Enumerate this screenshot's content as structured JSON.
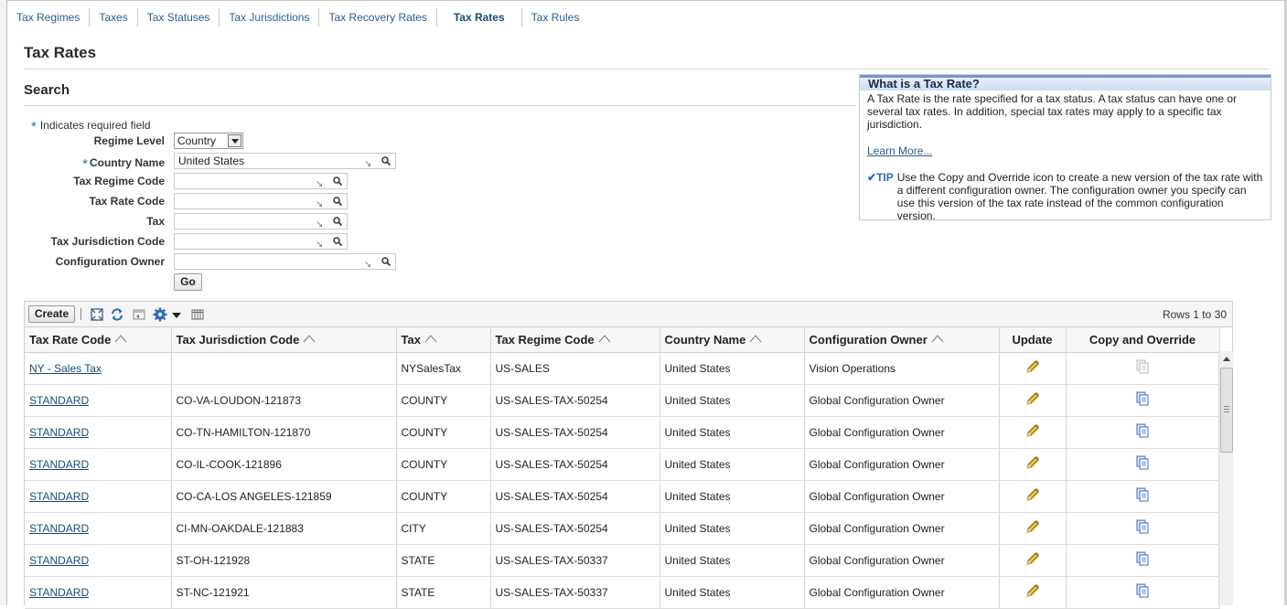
{
  "subtabs": [
    {
      "label": "Tax Regimes"
    },
    {
      "label": "Taxes"
    },
    {
      "label": "Tax Statuses"
    },
    {
      "label": "Tax Jurisdictions"
    },
    {
      "label": "Tax Recovery Rates"
    },
    {
      "label": "Tax Rates",
      "active": true
    },
    {
      "label": "Tax Rules"
    }
  ],
  "page": {
    "title": "Tax Rates",
    "search_title": "Search",
    "required_note": "Indicates required field"
  },
  "form": {
    "regime_level_label": "Regime Level",
    "regime_level_value": "Country",
    "country_name_label": "Country Name",
    "country_name_value": "United States",
    "tax_regime_code_label": "Tax Regime Code",
    "tax_rate_code_label": "Tax Rate Code",
    "tax_label": "Tax",
    "tax_jurisdiction_code_label": "Tax Jurisdiction Code",
    "configuration_owner_label": "Configuration Owner",
    "go_label": "Go"
  },
  "info": {
    "title": "What is a Tax Rate?",
    "text": "A Tax Rate is the rate specified for a tax status. A tax status can have one or several tax rates. In addition, special tax rates may apply to a specific tax jurisdiction.",
    "learn_more": "Learn More...",
    "tip_label": "TIP",
    "tip_text": "Use the Copy and Override icon to create a new version of the tax rate with a different configuration owner. The configuration owner you specify can use this version of the tax rate instead of the common configuration version."
  },
  "toolbar": {
    "create_label": "Create",
    "rows_info": "Rows 1 to 30"
  },
  "table": {
    "columns": [
      "Tax Rate Code",
      "Tax Jurisdiction Code",
      "Tax",
      "Tax Regime Code",
      "Country Name",
      "Configuration Owner",
      "Update",
      "Copy and Override"
    ],
    "rows": [
      {
        "rate_code": "NY - Sales Tax",
        "jurisdiction": "",
        "tax": "NYSalesTax",
        "regime": "US-SALES",
        "country": "United States",
        "owner": "Vision Operations",
        "copy_disabled": true
      },
      {
        "rate_code": "STANDARD",
        "jurisdiction": "CO-VA-LOUDON-121873",
        "tax": "COUNTY",
        "regime": "US-SALES-TAX-50254",
        "country": "United States",
        "owner": "Global Configuration Owner",
        "copy_disabled": false
      },
      {
        "rate_code": "STANDARD",
        "jurisdiction": "CO-TN-HAMILTON-121870",
        "tax": "COUNTY",
        "regime": "US-SALES-TAX-50254",
        "country": "United States",
        "owner": "Global Configuration Owner",
        "copy_disabled": false
      },
      {
        "rate_code": "STANDARD",
        "jurisdiction": "CO-IL-COOK-121896",
        "tax": "COUNTY",
        "regime": "US-SALES-TAX-50254",
        "country": "United States",
        "owner": "Global Configuration Owner",
        "copy_disabled": false
      },
      {
        "rate_code": "STANDARD",
        "jurisdiction": "CO-CA-LOS ANGELES-121859",
        "tax": "COUNTY",
        "regime": "US-SALES-TAX-50254",
        "country": "United States",
        "owner": "Global Configuration Owner",
        "copy_disabled": false
      },
      {
        "rate_code": "STANDARD",
        "jurisdiction": "CI-MN-OAKDALE-121883",
        "tax": "CITY",
        "regime": "US-SALES-TAX-50254",
        "country": "United States",
        "owner": "Global Configuration Owner",
        "copy_disabled": false
      },
      {
        "rate_code": "STANDARD",
        "jurisdiction": "ST-OH-121928",
        "tax": "STATE",
        "regime": "US-SALES-TAX-50337",
        "country": "United States",
        "owner": "Global Configuration Owner",
        "copy_disabled": false
      },
      {
        "rate_code": "STANDARD",
        "jurisdiction": "ST-NC-121921",
        "tax": "STATE",
        "regime": "US-SALES-TAX-50337",
        "country": "United States",
        "owner": "Global Configuration Owner",
        "copy_disabled": false
      }
    ]
  },
  "colors": {
    "link": "#1b4a78",
    "accent": "#2b6cb0",
    "info_header_border": "#6e9ad4"
  },
  "icons": {
    "update": "pencil-icon",
    "copy": "copy-icon",
    "detach": "detach-icon",
    "refresh": "refresh-icon",
    "freeze": "freeze-icon",
    "settings": "gear-icon",
    "columns": "columns-icon",
    "search": "search-icon",
    "lov": "lov-arrow-icon"
  }
}
